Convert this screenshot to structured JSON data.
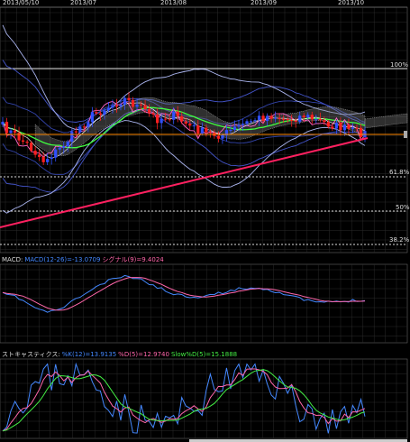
{
  "chart_data": [
    {
      "type": "candlestick",
      "start_label": "2013/05/10",
      "month_labels": [
        "2013/07",
        "2013/08",
        "2013/09",
        "2013/10"
      ],
      "fib_levels": [
        {
          "label": "100%",
          "value": 1.0
        },
        {
          "label": "61.8%",
          "value": 0.618
        },
        {
          "label": "50%",
          "value": 0.5
        },
        {
          "label": "38.2%",
          "value": 0.382
        }
      ],
      "grid": true,
      "colors": {
        "up": "#3050ff",
        "down": "#ff2020",
        "trendline": "#ff2060",
        "cloud": "#888888",
        "ma": "#40ff40",
        "bb": "#8899dd",
        "current": "#ff8800"
      }
    },
    {
      "type": "line",
      "panel": "MACD",
      "title": "MACD:",
      "series": [
        {
          "name": "MACD(12-26)=-13.0709",
          "color": "#4488ff"
        },
        {
          "name": "シグナル(9)=9.4024",
          "color": "#ff66aa"
        }
      ],
      "grid": true
    },
    {
      "type": "line",
      "panel": "Stochastics",
      "title": "ストキャスティクス:",
      "series": [
        {
          "name": "%K(12)=13.9135",
          "color": "#4488ff"
        },
        {
          "name": "%D(5)=12.9740",
          "color": "#ff66aa"
        },
        {
          "name": "Slow%D(5)=15.1888",
          "color": "#44ee44"
        }
      ],
      "grid": true
    }
  ]
}
